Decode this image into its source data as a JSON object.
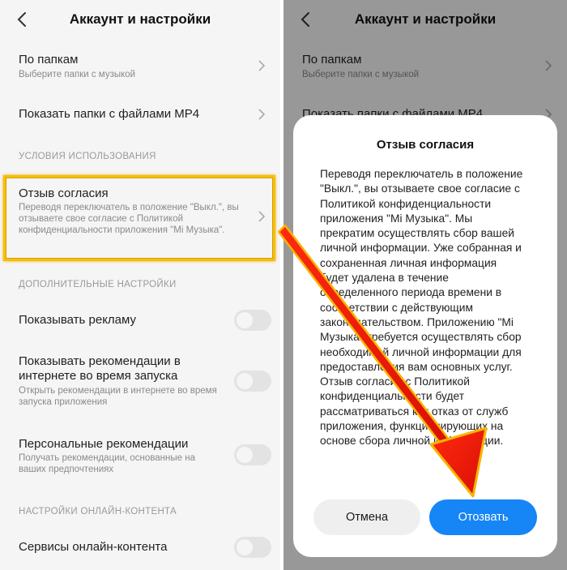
{
  "header": {
    "title": "Аккаунт и настройки"
  },
  "rows": {
    "folders": {
      "title": "По папкам",
      "subtitle": "Выберите папки с музыкой"
    },
    "mp4": {
      "title": "Показать папки с файлами MP4"
    },
    "consent": {
      "title": "Отзыв согласия",
      "subtitle": "Переводя переключатель в положение \"Выкл.\", вы отзываете свое согласие с Политикой конфиденциальности приложения \"Mi Музыка\"."
    },
    "ads": {
      "title": "Показывать рекламу",
      "enabled": false
    },
    "startup_recs": {
      "title": "Показывать рекомендации в интернете во время запуска",
      "subtitle": "Открыть рекомендации в интернете во время запуска приложения",
      "enabled": false
    },
    "personal_recs": {
      "title": "Персональные рекомендации",
      "subtitle": "Получать рекомендации, основанные на ваших предпочтениях",
      "enabled": false
    },
    "online_services": {
      "title": "Сервисы онлайн-контента",
      "enabled": false
    }
  },
  "sections": {
    "terms": "УСЛОВИЯ ИСПОЛЬЗОВАНИЯ",
    "additional": "ДОПОЛНИТЕЛЬНЫЕ НАСТРОЙКИ",
    "online": "НАСТРОЙКИ ОНЛАЙН-КОНТЕНТА"
  },
  "dialog": {
    "title": "Отзыв согласия",
    "body": "Переводя переключатель в положение \"Выкл.\", вы отзываете свое согласие с Политикой конфиденциальности приложения \"Mi Музыка\". Мы прекратим осуществлять сбор вашей личной информации. Уже собранная и сохраненная личная информация будет удалена в течение определенного периода времени в соответствии с действующим законодательством. Приложению \"Mi Музыка\" требуется осуществлять сбор необходимой личной информации для предоставления вам основных услуг. Отзыв согласия с Политикой конфиденциальности будет рассматриваться как отказ от служб приложения, функционирующих на основе сбора личной информации.",
    "cancel_label": "Отмена",
    "revoke_label": "Отозвать"
  },
  "colors": {
    "accent": "#1685f5",
    "highlight": "#f2c200",
    "arrow": "#e81c0c"
  },
  "icons": {
    "back": "back-arrow-icon",
    "chevron": "chevron-right-icon"
  }
}
